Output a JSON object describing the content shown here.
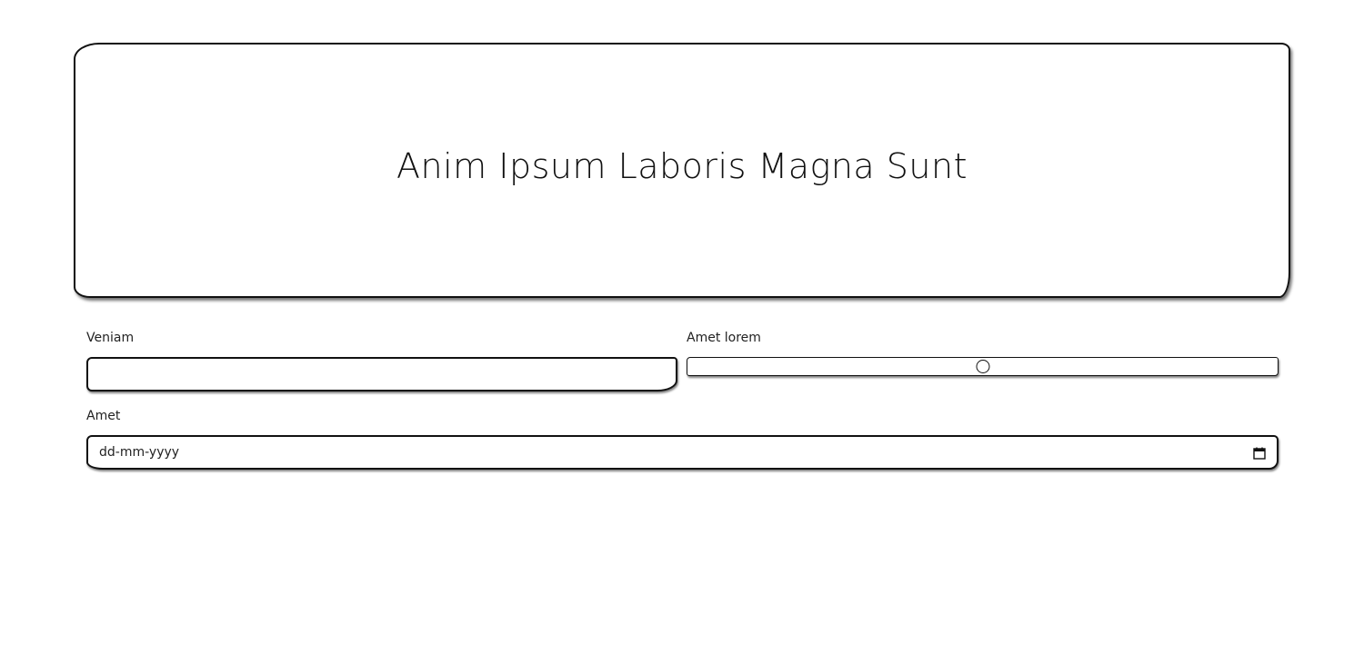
{
  "hero": {
    "title": "Anim Ipsum Laboris Magna Sunt"
  },
  "form": {
    "veniam": {
      "label": "Veniam",
      "value": ""
    },
    "amet_lorem": {
      "label": "Amet lorem",
      "value_percent": 50
    },
    "amet": {
      "label": "Amet",
      "placeholder": "dd-mm-yyyy",
      "icon": "calendar-icon"
    }
  }
}
